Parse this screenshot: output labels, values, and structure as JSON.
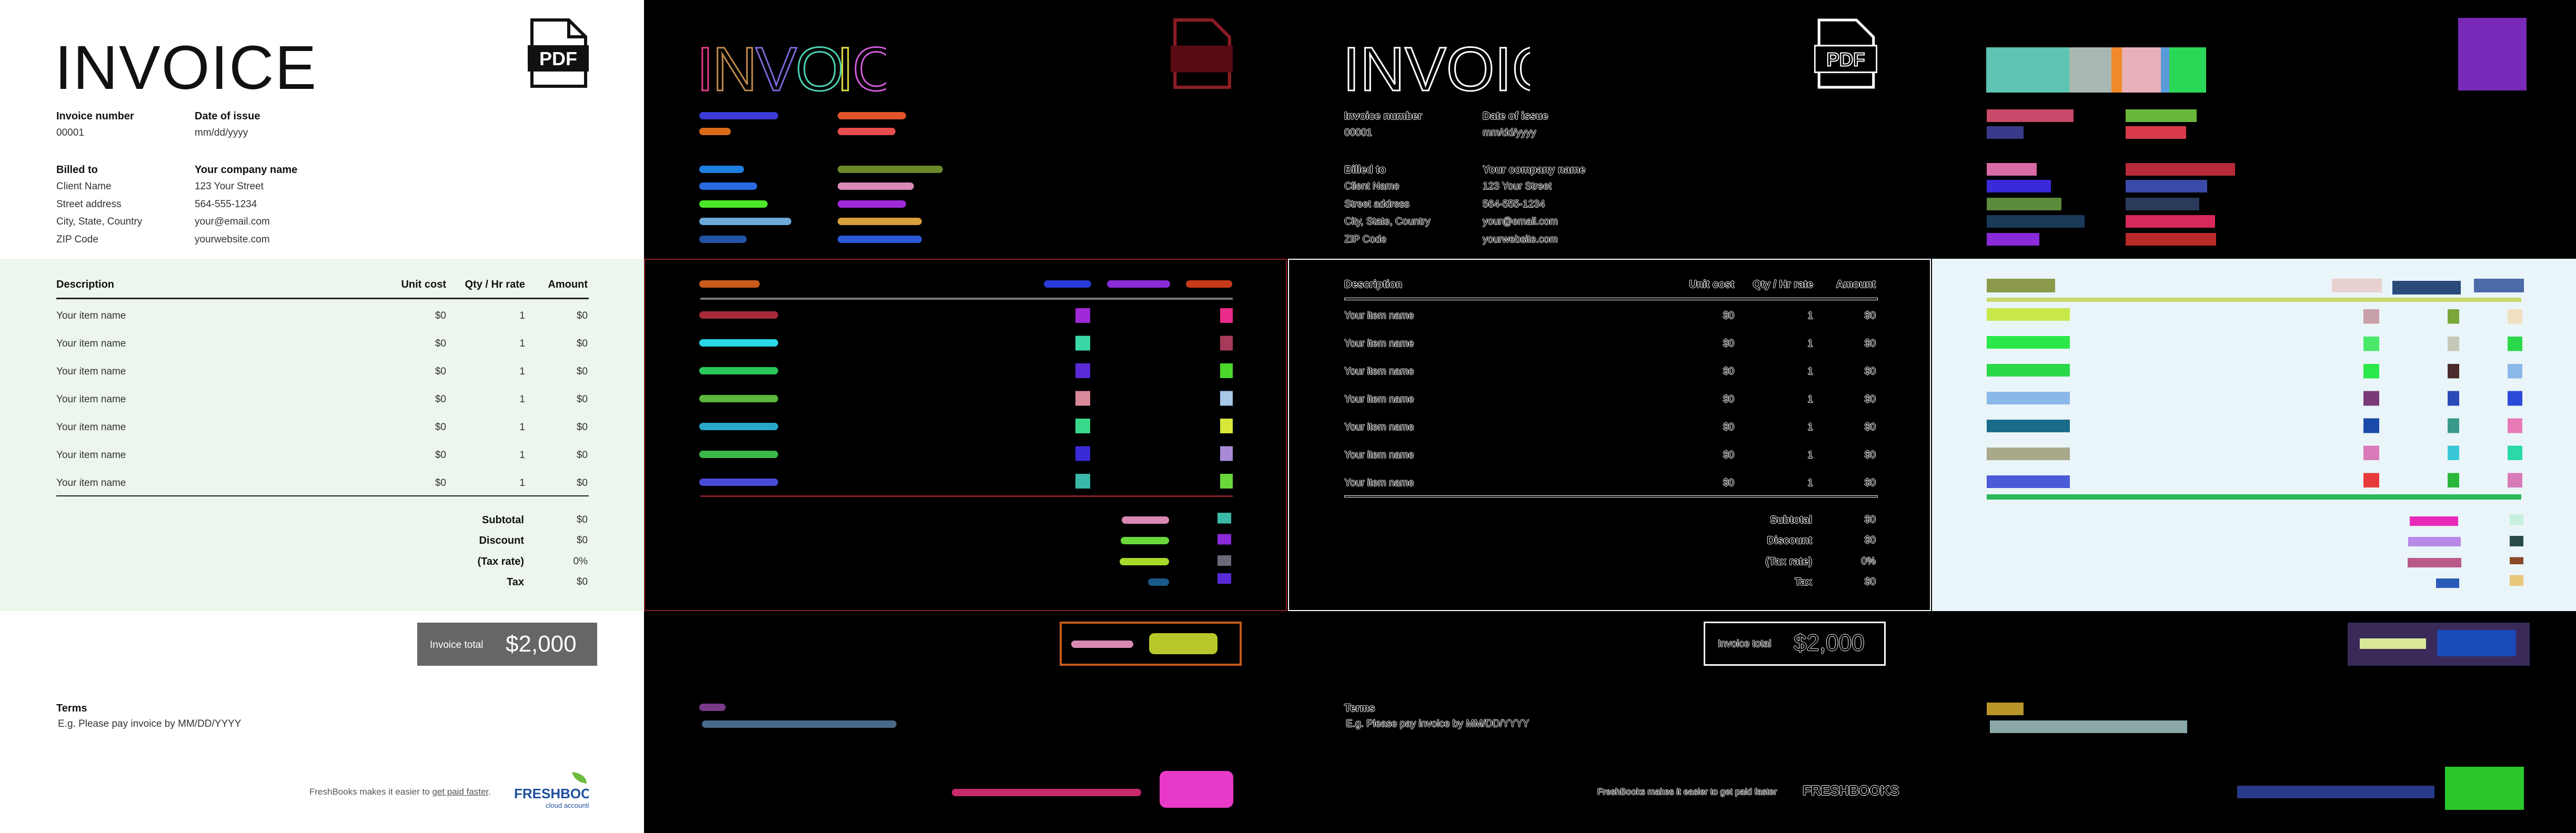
{
  "invoice": {
    "title": "INVOICE",
    "pdf_label": "PDF",
    "invoice_number_label": "Invoice number",
    "invoice_number": "00001",
    "date_label": "Date of issue",
    "date_value": "mm/dd/yyyy",
    "billed_to_label": "Billed to",
    "client": [
      "Client Name",
      "Street address",
      "City, State, Country",
      "ZIP Code"
    ],
    "company_label": "Your company name",
    "company": [
      "123 Your Street",
      "564-555-1234",
      "your@email.com",
      "yourwebsite.com"
    ],
    "columns": [
      "Description",
      "Unit cost",
      "Qty / Hr rate",
      "Amount"
    ],
    "items": [
      {
        "name": "Your item name",
        "cost": "$0",
        "qty": "1",
        "amount": "$0"
      },
      {
        "name": "Your item name",
        "cost": "$0",
        "qty": "1",
        "amount": "$0"
      },
      {
        "name": "Your item name",
        "cost": "$0",
        "qty": "1",
        "amount": "$0"
      },
      {
        "name": "Your item name",
        "cost": "$0",
        "qty": "1",
        "amount": "$0"
      },
      {
        "name": "Your item name",
        "cost": "$0",
        "qty": "1",
        "amount": "$0"
      },
      {
        "name": "Your item name",
        "cost": "$0",
        "qty": "1",
        "amount": "$0"
      },
      {
        "name": "Your item name",
        "cost": "$0",
        "qty": "1",
        "amount": "$0"
      }
    ],
    "totals": [
      {
        "label": "Subtotal",
        "value": "$0"
      },
      {
        "label": "Discount",
        "value": "$0"
      },
      {
        "label": "(Tax rate)",
        "value": "0%"
      },
      {
        "label": "Tax",
        "value": "$0"
      }
    ],
    "invoice_total_label": "Invoice total",
    "invoice_total": "$2,000",
    "terms_label": "Terms",
    "terms_text": "E.g. Please pay invoice by MM/DD/YYYY",
    "footer_text": "FreshBooks makes it easier to",
    "footer_link": "get paid faster",
    "footer_period": ".",
    "logo_text": "FRESHBOOKS",
    "logo_sub": "cloud accounting"
  },
  "colors": {
    "band": "#edf6ec",
    "total_box": "#666666",
    "logo_blue": "#1d4f9c",
    "logo_green": "#6cbb3c"
  }
}
